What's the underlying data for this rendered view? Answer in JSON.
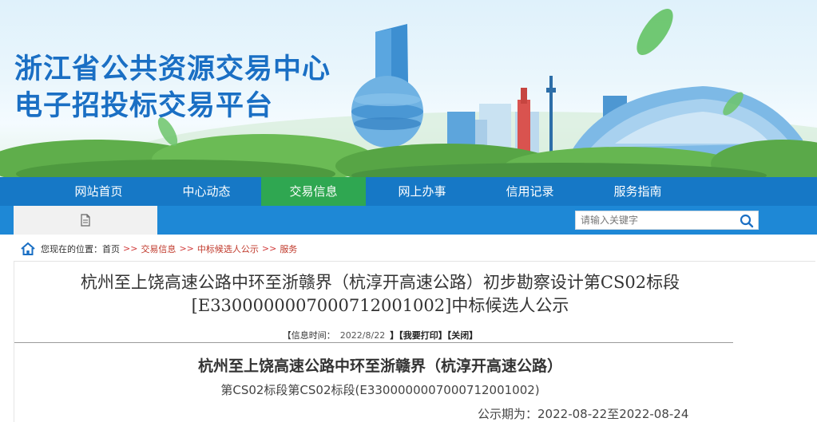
{
  "header": {
    "title_line1": "浙江省公共资源交易中心",
    "title_line2": "电子招投标交易平台"
  },
  "nav": {
    "items": [
      {
        "label": "网站首页",
        "active": false
      },
      {
        "label": "中心动态",
        "active": false
      },
      {
        "label": "交易信息",
        "active": true
      },
      {
        "label": "网上办事",
        "active": false
      },
      {
        "label": "信用记录",
        "active": false
      },
      {
        "label": "服务指南",
        "active": false
      }
    ]
  },
  "search": {
    "placeholder": "请输入关键字"
  },
  "breadcrumb": {
    "prefix": "您现在的位置：",
    "items": [
      "首页",
      "交易信息",
      "中标候选人公示",
      "服务"
    ],
    "separator": ">>"
  },
  "article": {
    "title_line1": "杭州至上饶高速公路中环至浙赣界（杭淳开高速公路）初步勘察设计第CS02标段",
    "title_line2": "[E3300000007000712001002]中标候选人公示",
    "meta_label": "【信息时间：",
    "meta_date": "2022/8/22",
    "print_label": "】【我要打印】",
    "close_label": "【关闭】",
    "body_heading": "杭州至上饶高速公路中环至浙赣界（杭淳开高速公路）",
    "body_subheading": "第CS02标段第CS02标段(E3300000007000712001002)",
    "period_label": "公示期为：",
    "period_value": "2022-08-22至2022-08-24"
  },
  "colors": {
    "nav_bg": "#1678c6",
    "nav_active": "#2fa751",
    "subbar_bg": "#1e88d6",
    "title_blue": "#1a6fc4"
  }
}
